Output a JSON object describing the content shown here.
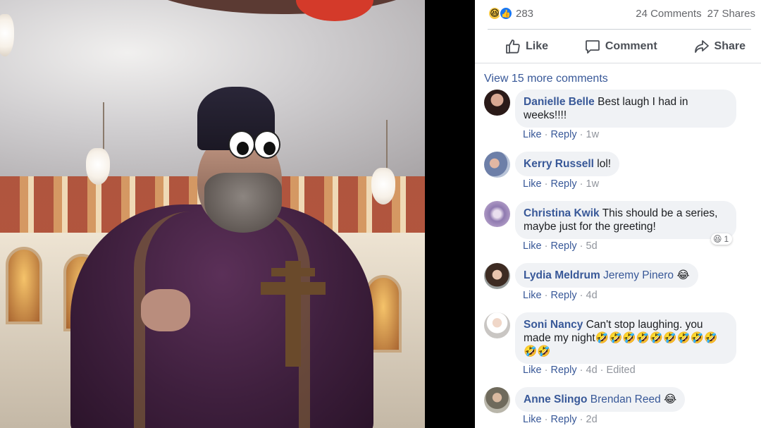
{
  "reactions": {
    "icons": [
      "haha-reaction-icon",
      "like-reaction-icon"
    ],
    "haha_glyph": "😆",
    "like_glyph": "👍",
    "count": "283",
    "comments_count": "24 Comments",
    "shares_count": "27 Shares"
  },
  "actions": {
    "like": "Like",
    "comment": "Comment",
    "share": "Share"
  },
  "view_more": "View 15 more comments",
  "comments": [
    {
      "author": "Danielle Belle",
      "text": "Best laugh I had in",
      "text2": "weeks!!!!",
      "like": "Like",
      "reply": "Reply",
      "time": "1w"
    },
    {
      "author": "Kerry Russell",
      "text": "lol!",
      "like": "Like",
      "reply": "Reply",
      "time": "1w"
    },
    {
      "author": "Christina Kwik",
      "text": "This should be a series,",
      "text2": "maybe just for the greeting!",
      "like": "Like",
      "reply": "Reply",
      "time": "5d",
      "reaction_glyph": "😆",
      "reaction_count": "1"
    },
    {
      "author": "Lydia Meldrum",
      "tag": "Jeremy Pinero",
      "emoji": "😂",
      "like": "Like",
      "reply": "Reply",
      "time": "4d"
    },
    {
      "author": "Soni Nancy",
      "text": "Can't stop laughing. you",
      "text2": "made my night",
      "emoji_line": "🤣🤣🤣🤣🤣🤣🤣🤣🤣",
      "emoji_line2": "🤣🤣",
      "like": "Like",
      "reply": "Reply",
      "time": "4d",
      "edited": "Edited"
    },
    {
      "author": "Anne Slingo",
      "tag": "Brendan Reed",
      "emoji": "😂",
      "like": "Like",
      "reply": "Reply",
      "time": "2d"
    }
  ],
  "sep": "·",
  "colors": {
    "link": "#385898",
    "bubble": "#f0f2f5",
    "meta": "#90949c"
  }
}
